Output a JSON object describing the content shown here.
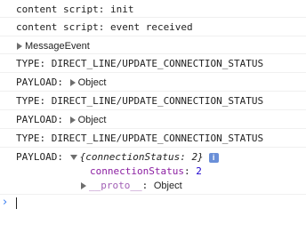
{
  "console": {
    "lines": [
      {
        "text": "content script: init"
      },
      {
        "text": "content script: event received"
      },
      {
        "text": "MessageEvent"
      },
      {
        "text": "TYPE: DIRECT_LINE/UPDATE_CONNECTION_STATUS"
      },
      {
        "label": "PAYLOAD:",
        "value": "Object"
      },
      {
        "text": "TYPE: DIRECT_LINE/UPDATE_CONNECTION_STATUS"
      },
      {
        "label": "PAYLOAD:",
        "value": "Object"
      },
      {
        "text": "TYPE: DIRECT_LINE/UPDATE_CONNECTION_STATUS"
      }
    ],
    "expanded": {
      "label": "PAYLOAD:",
      "preview": "{connectionStatus: 2}",
      "info_glyph": "i",
      "prop_key": "connectionStatus",
      "prop_colon": ":",
      "prop_value": "2",
      "proto_key": "__proto__",
      "proto_colon": ":",
      "proto_value": "Object"
    },
    "prompt_glyph": "›"
  }
}
